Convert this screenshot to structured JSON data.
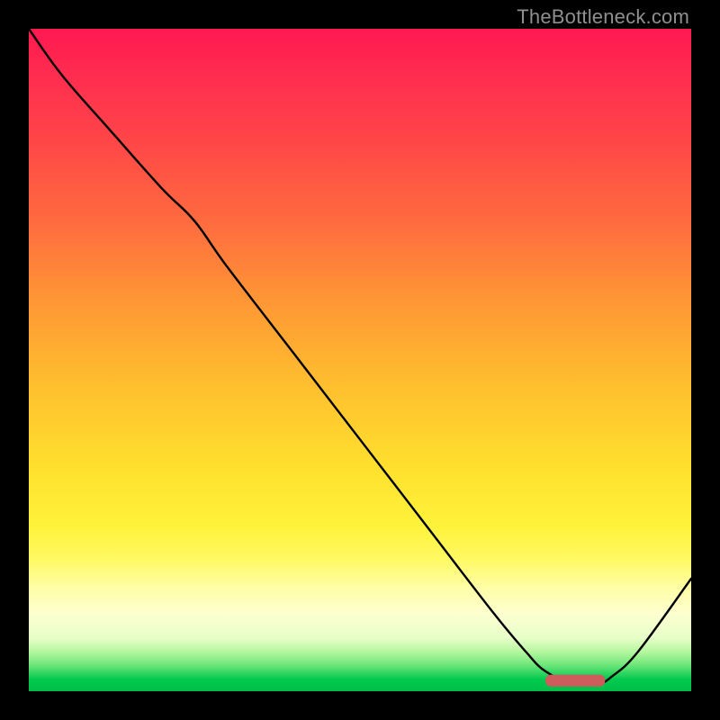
{
  "watermark": "TheBottleneck.com",
  "chart_data": {
    "type": "line",
    "title": "",
    "xlabel": "",
    "ylabel": "",
    "xlim": [
      0,
      100
    ],
    "ylim": [
      0,
      100
    ],
    "grid": false,
    "series": [
      {
        "name": "bottleneck-curve",
        "color": "#000000",
        "x": [
          0,
          5,
          12,
          20,
          25,
          30,
          40,
          50,
          60,
          70,
          75,
          78,
          82,
          86,
          88,
          92,
          100
        ],
        "values": [
          100,
          93,
          85,
          76,
          71,
          64,
          51,
          38,
          25,
          12,
          6,
          3,
          1.2,
          1.2,
          2.2,
          6,
          17
        ]
      }
    ],
    "annotations": [
      {
        "name": "optimum-marker",
        "color": "#cd5c5c",
        "shape": "rounded-bar",
        "x_range": [
          78,
          87
        ],
        "y": 1.6,
        "height": 1.8
      }
    ],
    "background": {
      "type": "vertical-gradient",
      "stops": [
        {
          "pct": 0,
          "color": "#ff1850"
        },
        {
          "pct": 17,
          "color": "#ff4648"
        },
        {
          "pct": 42,
          "color": "#ff9a34"
        },
        {
          "pct": 67,
          "color": "#ffe22e"
        },
        {
          "pct": 85,
          "color": "#fffea8"
        },
        {
          "pct": 96,
          "color": "#6fe77a"
        },
        {
          "pct": 100,
          "color": "#00bf48"
        }
      ]
    }
  }
}
